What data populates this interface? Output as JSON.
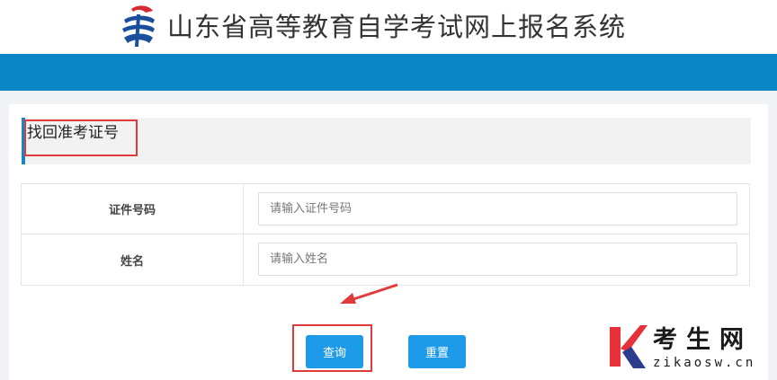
{
  "header": {
    "title": "山东省高等教育自学考试网上报名系统"
  },
  "section": {
    "title": "找回准考证号"
  },
  "form": {
    "rows": [
      {
        "label": "证件号码",
        "placeholder": "请输入证件号码",
        "value": ""
      },
      {
        "label": "姓名",
        "placeholder": "请输入姓名",
        "value": ""
      }
    ]
  },
  "buttons": {
    "query_label": "查询",
    "reset_label": "重置"
  },
  "watermark": {
    "cn_text": "考生网",
    "en_text": "zikaosw.cn"
  },
  "colors": {
    "brand_blue": "#0a86c6",
    "button_blue": "#1e9be8",
    "annotation_red": "#e03a3a",
    "watermark_red": "#e6313a"
  },
  "icons": {
    "site_logo": "swirl-logo-icon",
    "annotation_arrow": "arrow-icon",
    "watermark_logo": "k-logo-icon"
  }
}
